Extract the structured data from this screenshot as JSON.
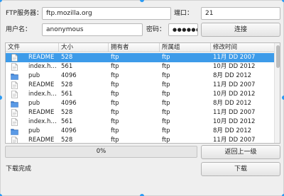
{
  "connection": {
    "server_label": "FTP服务器：",
    "server_value": "ftp.mozilla.org",
    "port_label": "端口：",
    "port_value": "21",
    "user_label": "用户名：",
    "user_value": "anonymous",
    "password_label": "密码：",
    "password_value": "●●●●●●",
    "connect_label": "连接"
  },
  "file_table": {
    "headers": [
      "文件",
      "大小",
      "拥有者",
      "所属组",
      "修改时间"
    ],
    "rows": [
      {
        "icon": "file-icon",
        "name": "README",
        "size": "528",
        "owner": "ftp",
        "group": "ftp",
        "modified": "11月 DD 2007",
        "selected": true
      },
      {
        "icon": "file-icon",
        "name": "index.h…",
        "size": "561",
        "owner": "ftp",
        "group": "ftp",
        "modified": "10月 DD 2012",
        "selected": false
      },
      {
        "icon": "folder-icon",
        "name": "pub",
        "size": "4096",
        "owner": "ftp",
        "group": "ftp",
        "modified": "8月 DD 2012",
        "selected": false
      },
      {
        "icon": "file-icon",
        "name": "README",
        "size": "528",
        "owner": "ftp",
        "group": "ftp",
        "modified": "11月 DD 2007",
        "selected": false
      },
      {
        "icon": "file-icon",
        "name": "index.h…",
        "size": "561",
        "owner": "ftp",
        "group": "ftp",
        "modified": "10月 DD 2012",
        "selected": false
      },
      {
        "icon": "folder-icon",
        "name": "pub",
        "size": "4096",
        "owner": "ftp",
        "group": "ftp",
        "modified": "8月 DD 2012",
        "selected": false
      },
      {
        "icon": "file-icon",
        "name": "README",
        "size": "528",
        "owner": "ftp",
        "group": "ftp",
        "modified": "11月 DD 2007",
        "selected": false
      },
      {
        "icon": "file-icon",
        "name": "index.h…",
        "size": "561",
        "owner": "ftp",
        "group": "ftp",
        "modified": "10月 DD 2012",
        "selected": false
      },
      {
        "icon": "folder-icon",
        "name": "pub",
        "size": "4096",
        "owner": "ftp",
        "group": "ftp",
        "modified": "8月 DD 2012",
        "selected": false
      },
      {
        "icon": "file-icon",
        "name": "README",
        "size": "528",
        "owner": "ftp",
        "group": "ftp",
        "modified": "11月 DD 2007",
        "selected": false
      }
    ]
  },
  "progress": {
    "percent": 0,
    "text": "0%"
  },
  "back_label": "返回上一级",
  "status_text": "下载完成",
  "download_label": "下载",
  "colors": {
    "selection": "#3d9be9",
    "selection_text": "#ffffff",
    "handle": "#2b9af3",
    "folder": "#3b7fd4"
  }
}
